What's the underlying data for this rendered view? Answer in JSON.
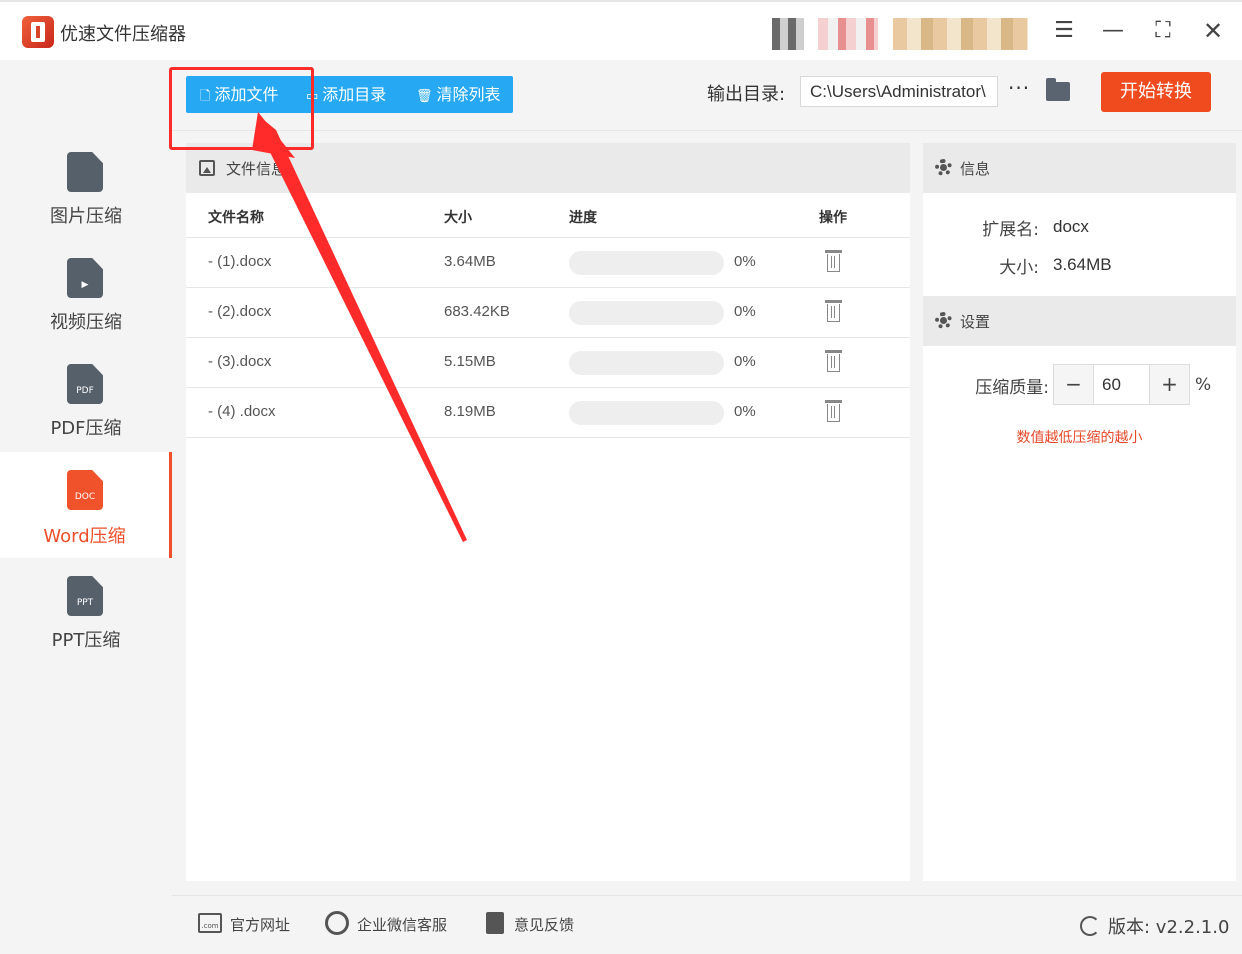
{
  "app": {
    "title": "优速文件压缩器"
  },
  "window": {
    "menu_icon": "hamburger-menu-icon",
    "min_icon": "minimize-icon",
    "max_icon": "maximize-icon",
    "close_icon": "close-icon"
  },
  "sidebar": {
    "items": [
      {
        "label": "图片压缩",
        "mark": "",
        "icon": "image-file-icon",
        "active": false
      },
      {
        "label": "视频压缩",
        "mark": "▶",
        "icon": "video-file-icon",
        "active": false
      },
      {
        "label": "PDF压缩",
        "mark": "PDF",
        "icon": "pdf-file-icon",
        "active": false
      },
      {
        "label": "Word压缩",
        "mark": "DOC",
        "icon": "doc-file-icon",
        "active": true
      },
      {
        "label": "PPT压缩",
        "mark": "PPT",
        "icon": "ppt-file-icon",
        "active": false
      }
    ]
  },
  "toolbar": {
    "add_file": "添加文件",
    "add_dir": "添加目录",
    "clear_list": "清除列表",
    "output_label": "输出目录:",
    "output_path": "C:\\Users\\Administrator\\",
    "more": "···",
    "start": "开始转换"
  },
  "file_panel": {
    "title": "文件信息",
    "columns": {
      "name": "文件名称",
      "size": "大小",
      "progress": "进度",
      "action": "操作"
    },
    "rows": [
      {
        "name": "- (1).docx",
        "size": "3.64MB",
        "progress": "0%",
        "progress_value": 0
      },
      {
        "name": "- (2).docx",
        "size": "683.42KB",
        "progress": "0%",
        "progress_value": 0
      },
      {
        "name": "- (3).docx",
        "size": "5.15MB",
        "progress": "0%",
        "progress_value": 0
      },
      {
        "name": "- (4) .docx",
        "size": "8.19MB",
        "progress": "0%",
        "progress_value": 0
      }
    ]
  },
  "info_panel": {
    "title": "信息",
    "ext_label": "扩展名:",
    "ext_value": "docx",
    "size_label": "大小:",
    "size_value": "3.64MB"
  },
  "settings_panel": {
    "title": "设置",
    "quality_label": "压缩质量:",
    "quality_value": "60",
    "minus": "−",
    "plus": "+",
    "unit": "%",
    "hint": "数值越低压缩的越小"
  },
  "footer": {
    "website": "官方网址",
    "website_icon_text": ".com",
    "wechat": "企业微信客服",
    "feedback": "意见反馈",
    "version": "版本: v2.2.1.0"
  },
  "colors": {
    "accent": "#ee4e2b",
    "toolbar_blue": "#27a8f2",
    "start_button": "#f04a1f",
    "annotation": "#ff2b2b"
  }
}
